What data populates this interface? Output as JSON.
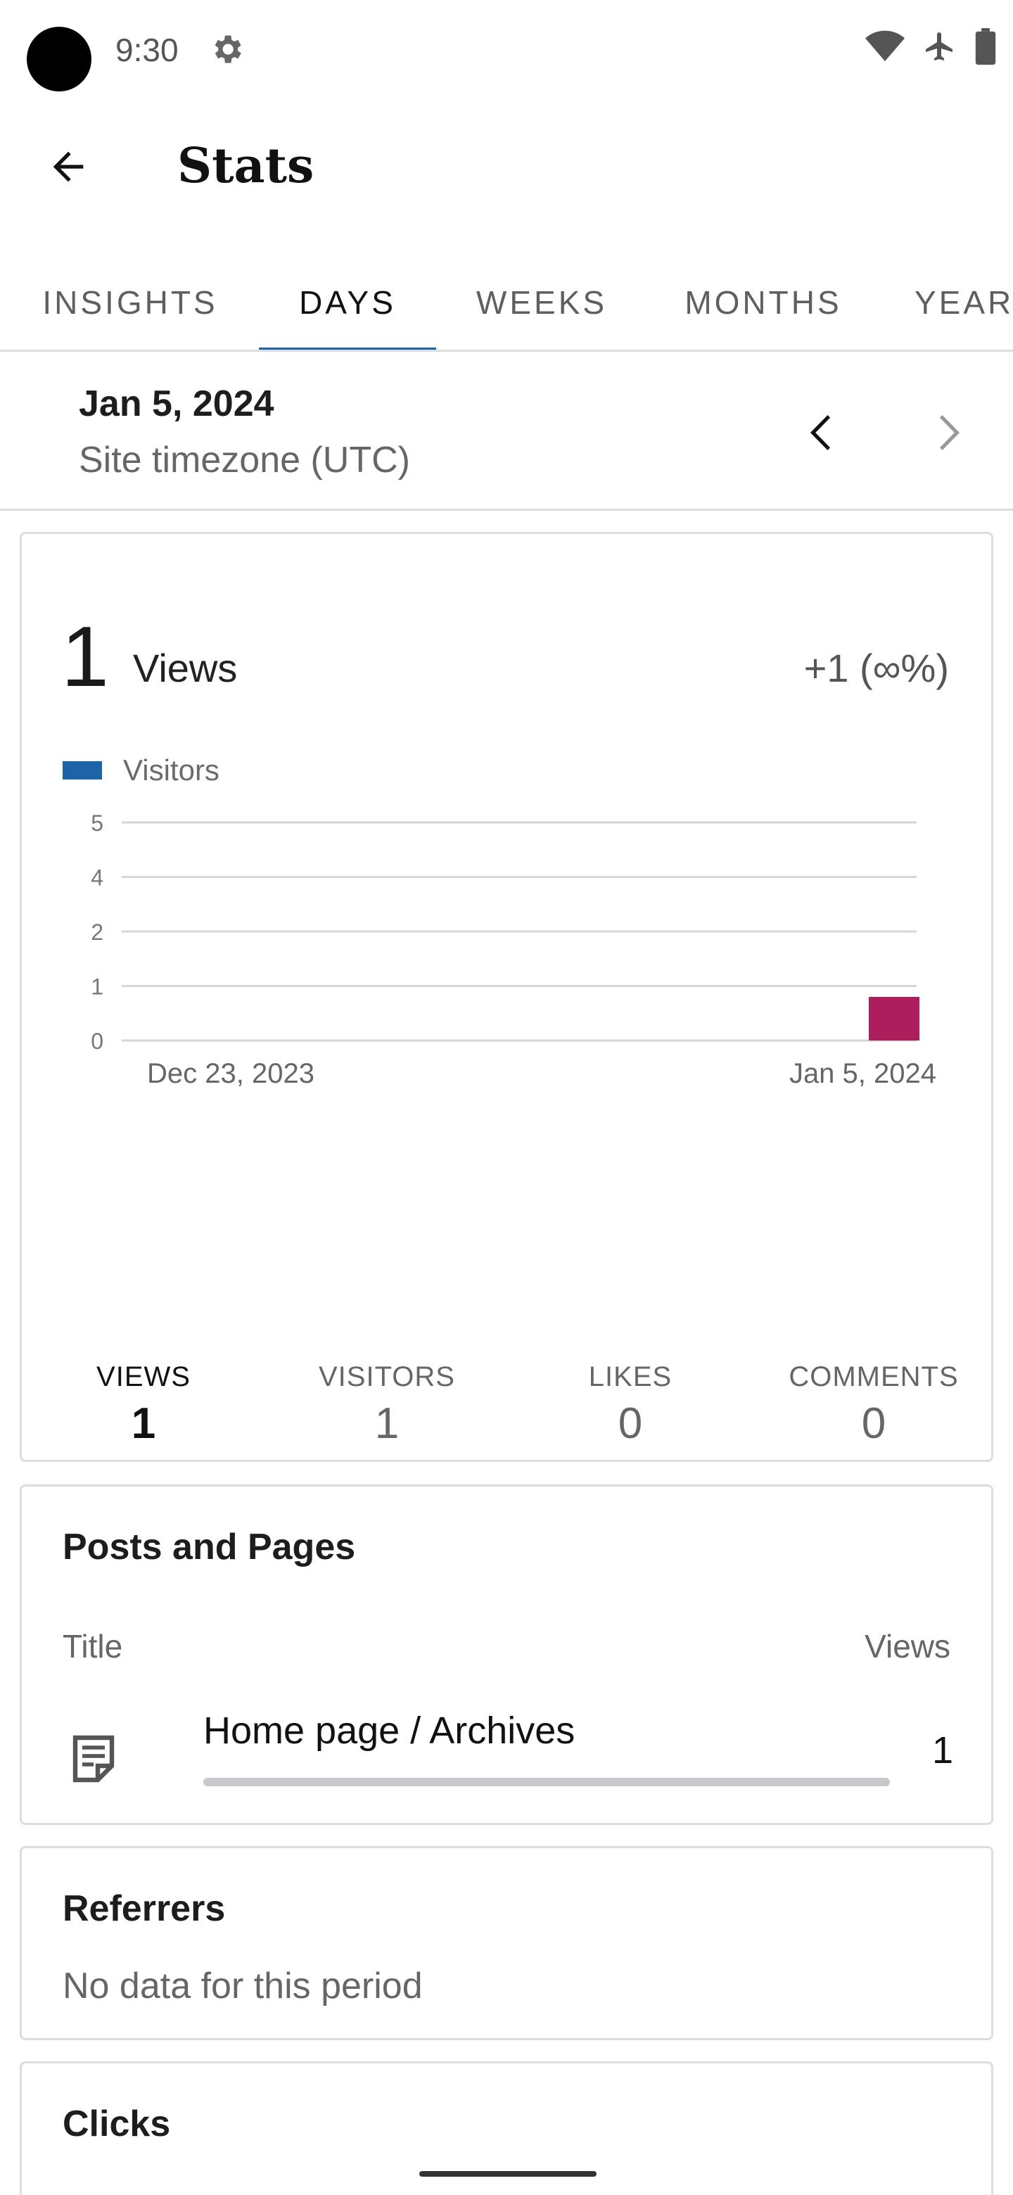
{
  "status_bar": {
    "time": "9:30",
    "icons": [
      "gear-icon",
      "wifi-icon",
      "airplane-icon",
      "battery-icon"
    ]
  },
  "app_bar": {
    "title": "Stats"
  },
  "tabs": [
    {
      "label": "INSIGHTS",
      "active": false
    },
    {
      "label": "DAYS",
      "active": true
    },
    {
      "label": "WEEKS",
      "active": false
    },
    {
      "label": "MONTHS",
      "active": false
    },
    {
      "label": "YEARS",
      "active": false
    }
  ],
  "date_header": {
    "date": "Jan 5, 2024",
    "timezone": "Site timezone (UTC)"
  },
  "overview": {
    "value": "1",
    "label": "Views",
    "change": "+1 (∞%)",
    "legend": "Visitors",
    "colors": {
      "legend": "#1e63a6",
      "bar": "#ad1f5c",
      "accent": "#1e63a6"
    }
  },
  "chart_data": {
    "type": "bar",
    "categories": [
      "Dec 23, 2023",
      "Jan 5, 2024"
    ],
    "x_tick_labels": [
      "Dec 23, 2023",
      "Jan 5, 2024"
    ],
    "y_tick_labels": [
      "0",
      "1",
      "2",
      "4",
      "5"
    ],
    "series": [
      {
        "name": "Visitors",
        "values": [
          0,
          0,
          0,
          0,
          0,
          0,
          0,
          0,
          0,
          0,
          0,
          0,
          0,
          1
        ]
      }
    ],
    "ylim": [
      0,
      5
    ],
    "grid": true,
    "legend": "top-left"
  },
  "metrics": [
    {
      "label": "VIEWS",
      "value": "1",
      "active": true
    },
    {
      "label": "VISITORS",
      "value": "1",
      "active": false
    },
    {
      "label": "LIKES",
      "value": "0",
      "active": false
    },
    {
      "label": "COMMENTS",
      "value": "0",
      "active": false
    }
  ],
  "posts_and_pages": {
    "title": "Posts and Pages",
    "col_title": "Title",
    "col_views": "Views",
    "rows": [
      {
        "title": "Home page / Archives",
        "views": "1",
        "bar_fraction": 1.0
      }
    ]
  },
  "referrers": {
    "title": "Referrers",
    "empty": "No data for this period"
  },
  "clicks": {
    "title": "Clicks"
  }
}
